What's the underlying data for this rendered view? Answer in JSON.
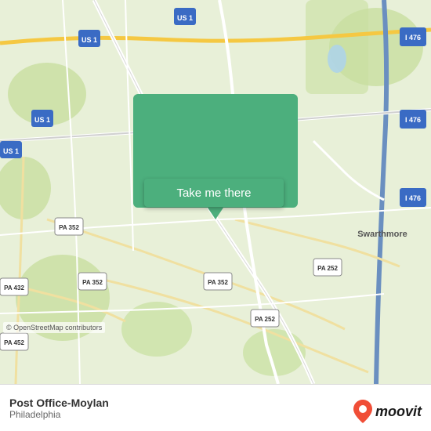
{
  "map": {
    "background_color": "#e8f0d8",
    "osm_credit": "© OpenStreetMap contributors"
  },
  "button": {
    "label": "Take me there"
  },
  "bottom_bar": {
    "place_name": "Post Office-Moylan",
    "place_city": "Philadelphia",
    "moovit_text": "moovit"
  }
}
